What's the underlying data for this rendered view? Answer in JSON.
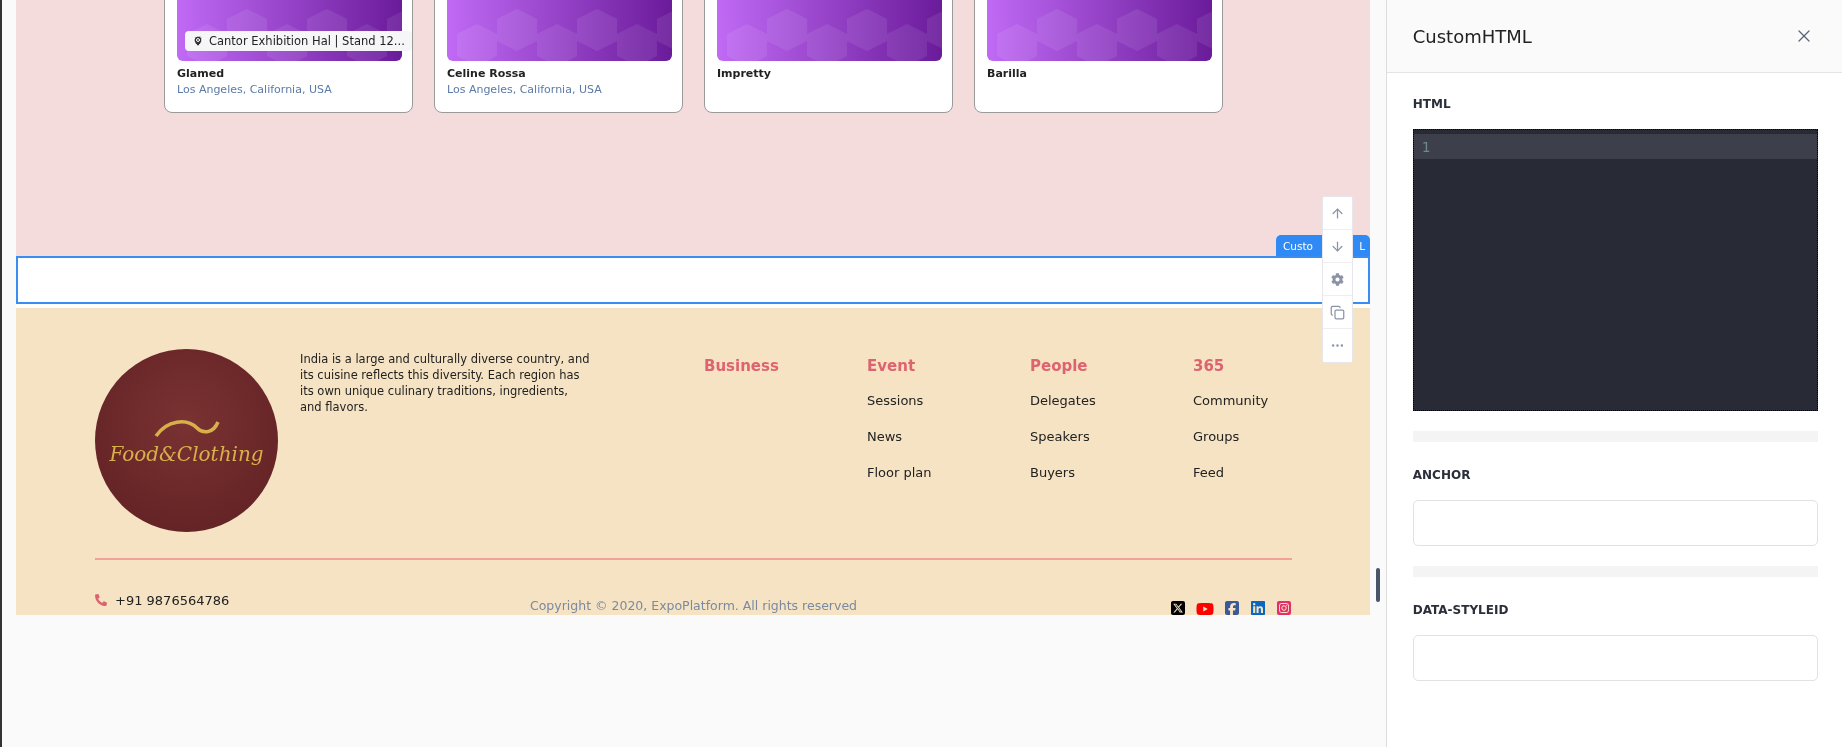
{
  "cards": [
    {
      "name": "Glamed",
      "location": "Los Angeles, California, USA",
      "stand": "Cantor Exhibition Hal | Stand 12..."
    },
    {
      "name": "Celine Rossa",
      "location": "Los Angeles, California, USA"
    },
    {
      "name": "Impretty"
    },
    {
      "name": "Barilla"
    }
  ],
  "selected_block": {
    "badge_start": "Custo",
    "badge_end": "L"
  },
  "toolbar": [
    {
      "kind": "up"
    },
    {
      "kind": "down"
    },
    {
      "kind": "settings"
    },
    {
      "kind": "copy"
    },
    {
      "kind": "more"
    }
  ],
  "footer": {
    "logo_text": "Food&Clothing",
    "description": "India is a large and culturally diverse country, and its cuisine reflects this diversity. Each region has its own unique culinary traditions, ingredients, and flavors.",
    "columns": [
      {
        "title": "Business"
      },
      {
        "title": "Event",
        "links": [
          "Sessions",
          "News",
          "Floor plan"
        ]
      },
      {
        "title": "People",
        "links": [
          "Delegates",
          "Speakers",
          "Buyers"
        ]
      },
      {
        "title": "365",
        "links": [
          "Community",
          "Groups",
          "Feed"
        ]
      }
    ],
    "phone": "+91 9876564786",
    "copyright": "Copyright © 2020, ExpoPlatform. All rights reserved",
    "social": [
      {
        "kind": "x"
      },
      {
        "kind": "youtube"
      },
      {
        "kind": "facebook"
      },
      {
        "kind": "linkedin"
      },
      {
        "kind": "instagram"
      }
    ]
  },
  "panel": {
    "title": "CustomHTML",
    "sections": [
      {
        "kind": "code",
        "label": "HTML",
        "line_numbers": [
          "1"
        ]
      },
      {
        "kind": "text",
        "label": "ANCHOR"
      },
      {
        "kind": "text",
        "label": "DATA-STYLEID"
      }
    ]
  }
}
